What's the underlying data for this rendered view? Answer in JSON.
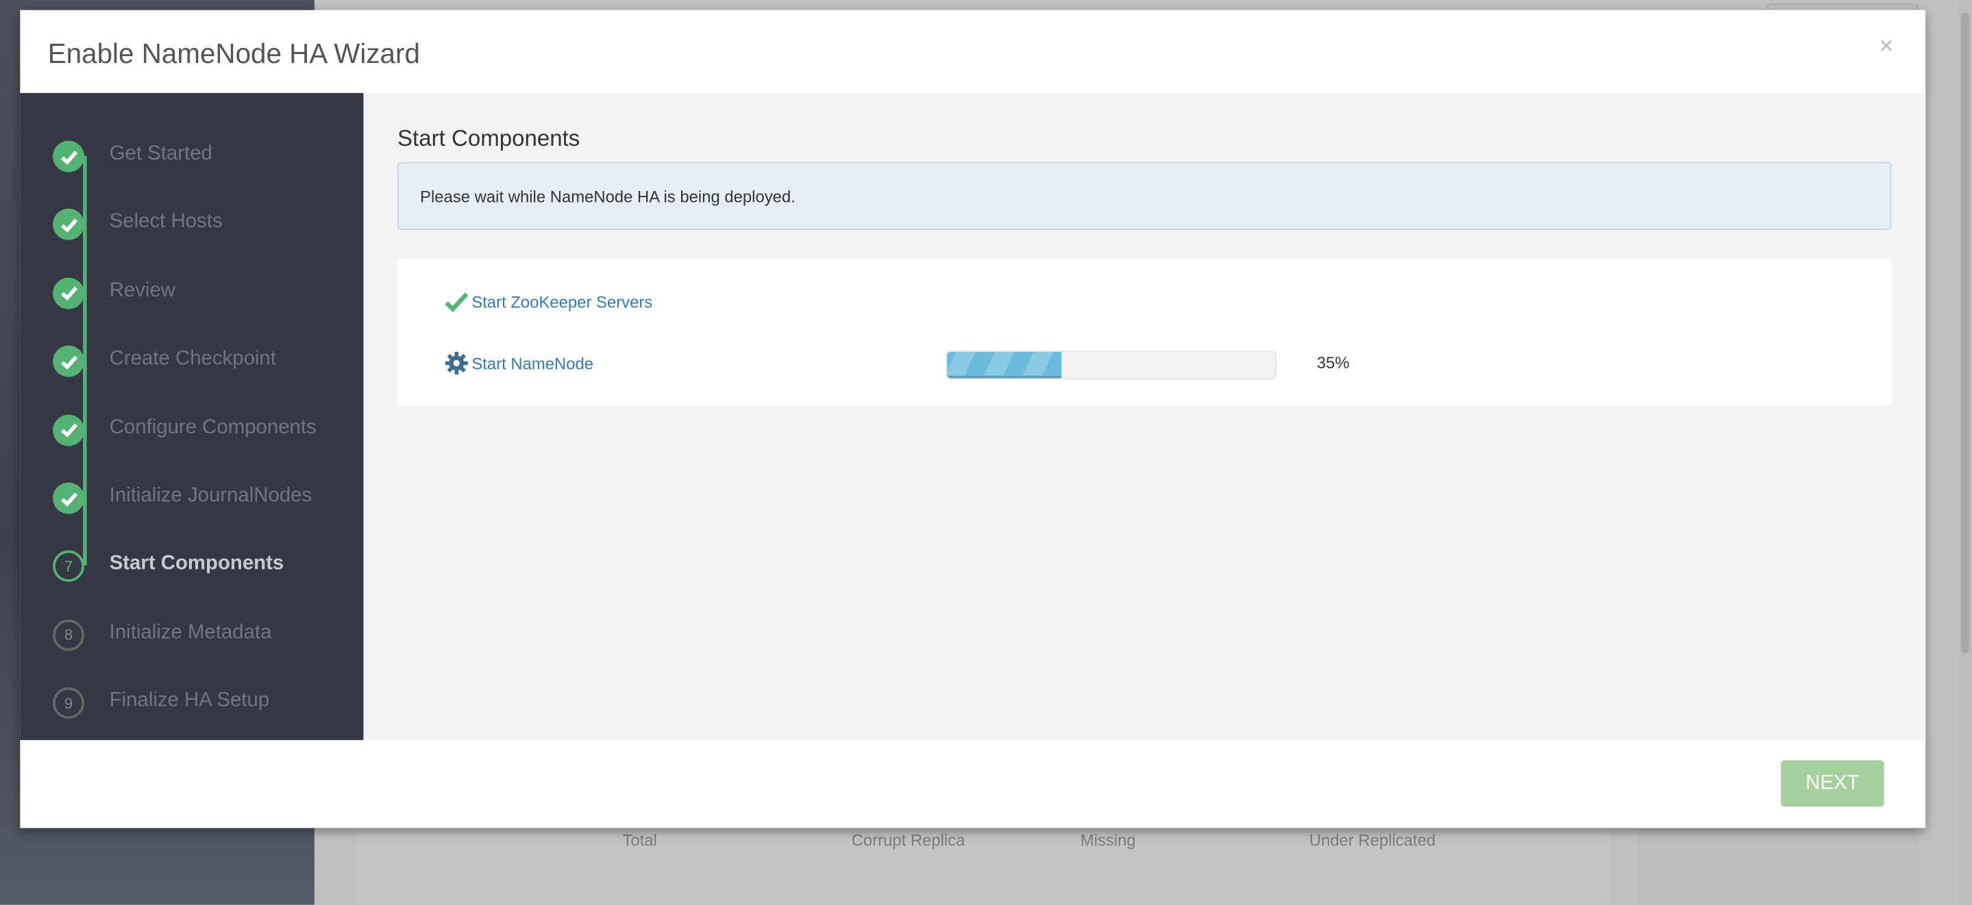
{
  "modal": {
    "title": "Enable NameNode HA Wizard",
    "close_label": "×"
  },
  "steps": [
    {
      "num": "1",
      "label": "Get Started",
      "status": "done"
    },
    {
      "num": "2",
      "label": "Select Hosts",
      "status": "done"
    },
    {
      "num": "3",
      "label": "Review",
      "status": "done"
    },
    {
      "num": "4",
      "label": "Create Checkpoint",
      "status": "done"
    },
    {
      "num": "5",
      "label": "Configure Components",
      "status": "done"
    },
    {
      "num": "6",
      "label": "Initialize JournalNodes",
      "status": "done"
    },
    {
      "num": "7",
      "label": "Start Components",
      "status": "current"
    },
    {
      "num": "8",
      "label": "Initialize Metadata",
      "status": "pending"
    },
    {
      "num": "9",
      "label": "Finalize HA Setup",
      "status": "pending"
    }
  ],
  "content": {
    "heading": "Start Components",
    "alert": "Please wait while NameNode HA is being deployed.",
    "tasks": [
      {
        "label": "Start ZooKeeper Servers",
        "status": "completed",
        "icon": "check-icon"
      },
      {
        "label": "Start NameNode",
        "status": "in-progress",
        "icon": "gear-icon",
        "progress": 35,
        "progress_label": "35%"
      }
    ]
  },
  "footer": {
    "next_label": "NEXT"
  },
  "background": {
    "labels": [
      "Total",
      "Corrupt Replica",
      "Missing",
      "Under Replicated"
    ]
  },
  "colors": {
    "success": "#54b374",
    "link": "#337ab7",
    "sidebar": "#353745",
    "next_disabled": "#a6d09b"
  }
}
